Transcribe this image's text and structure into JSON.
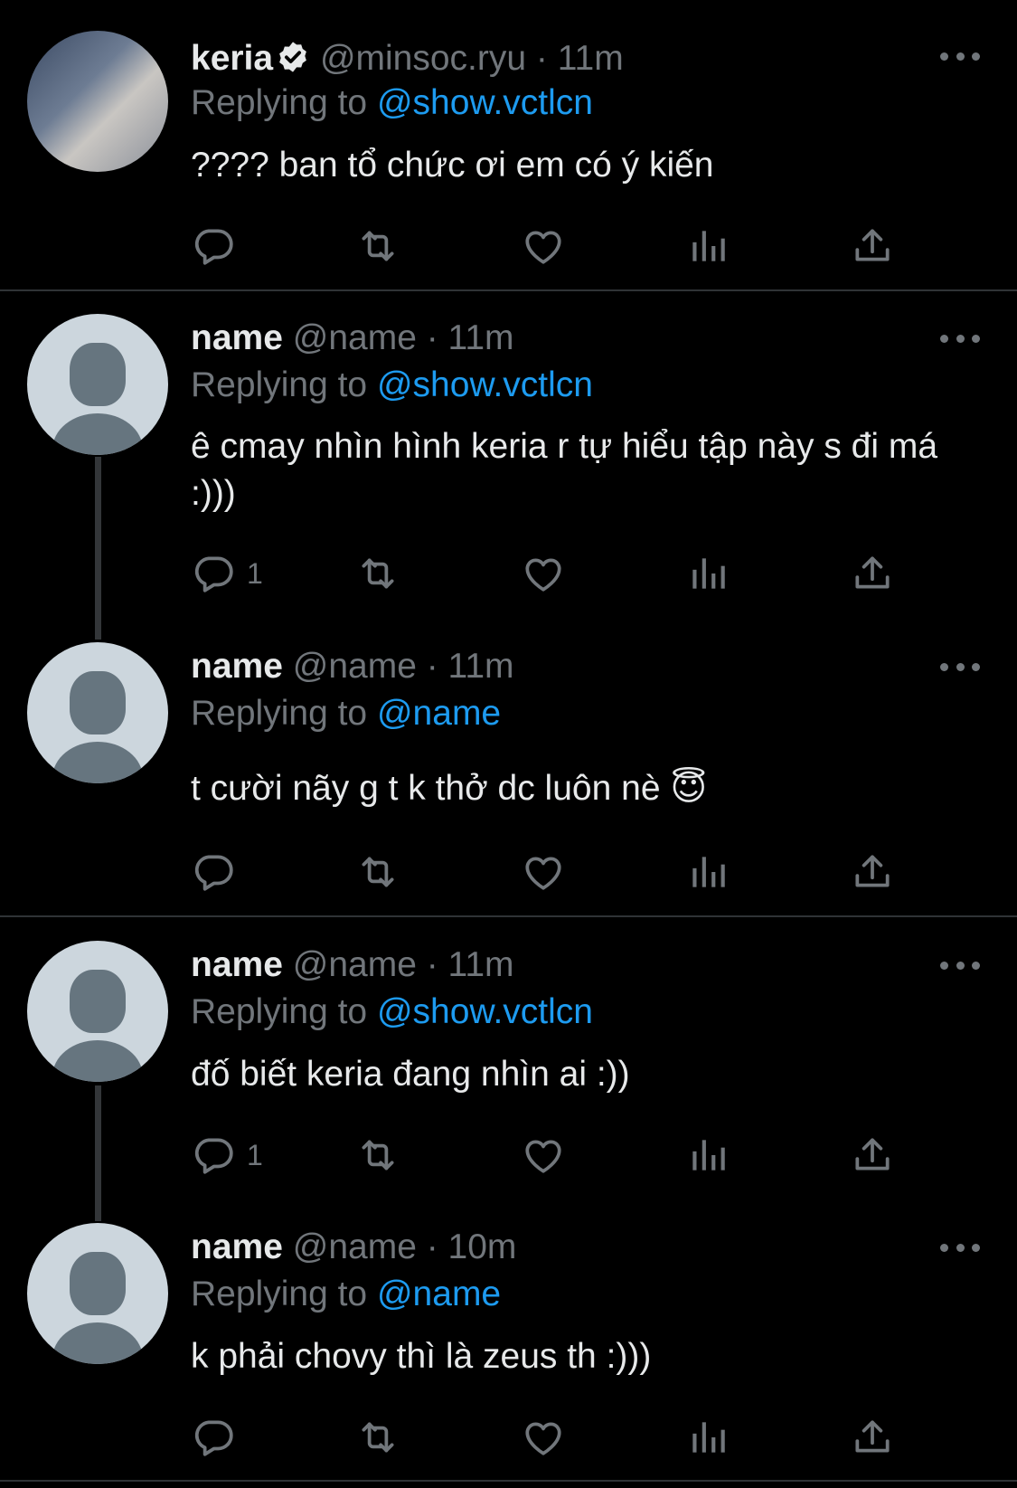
{
  "tweets": [
    {
      "name": "keria",
      "verified": true,
      "handle": "@minsoc.ryu",
      "time": "· 11m",
      "replying_prefix": "Replying to",
      "replying_to": "@show.vctlcn",
      "text": "???? ban tổ chức ơi em có ý kiến",
      "reply_count": ""
    },
    {
      "name": "name",
      "handle": "@name",
      "time": "· 11m",
      "replying_prefix": "Replying to",
      "replying_to": "@show.vctlcn",
      "text": "ê cmay nhìn hình keria r tự hiểu tập này s đi má :)))",
      "reply_count": "1"
    },
    {
      "name": "name",
      "handle": "@name",
      "time": "· 11m",
      "replying_prefix": "Replying to",
      "replying_to": "@name",
      "text": "t cười nãy g t k thở dc luôn nè 😇",
      "reply_count": ""
    },
    {
      "name": "name",
      "handle": "@name",
      "time": "· 11m",
      "replying_prefix": "Replying to",
      "replying_to": "@show.vctlcn",
      "text": "đố biết keria đang nhìn ai :))",
      "reply_count": "1"
    },
    {
      "name": "name",
      "handle": "@name",
      "time": "· 10m",
      "replying_prefix": "Replying to",
      "replying_to": "@name",
      "text": "k phải chovy thì là zeus th :)))",
      "reply_count": ""
    }
  ],
  "icons": {
    "reply": "reply-icon",
    "retweet": "retweet-icon",
    "like": "heart-icon",
    "views": "views-icon",
    "share": "share-icon",
    "more": "more-icon",
    "verified": "verified-badge-icon"
  },
  "colors": {
    "background": "#000000",
    "text": "#e7e9ea",
    "muted": "#71767b",
    "link": "#1d9bf0"
  }
}
